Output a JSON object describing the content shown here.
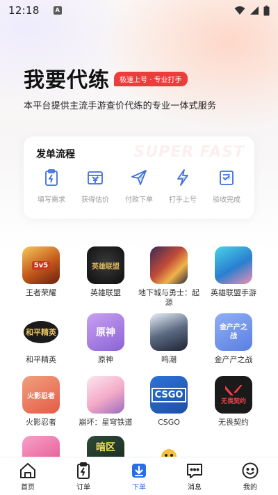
{
  "status_bar": {
    "time": "12:18",
    "indicator": "A"
  },
  "hero": {
    "title": "我要代练",
    "tag": "极速上号 · 专业打手",
    "subtitle": "本平台提供主流手游查价代练的专业一体式服务"
  },
  "flow": {
    "title": "发单流程",
    "watermark": "SUPER FAST",
    "steps": [
      {
        "label": "填写需求",
        "icon": "clipboard-icon"
      },
      {
        "label": "获得估价",
        "icon": "price-icon"
      },
      {
        "label": "付款下单",
        "icon": "send-icon"
      },
      {
        "label": "打手上号",
        "icon": "lightning-icon"
      },
      {
        "label": "验收完成",
        "icon": "checklist-icon"
      }
    ],
    "accent_color": "#3b6fe0"
  },
  "games": [
    {
      "name": "王者荣耀",
      "icon_text": "5v5"
    },
    {
      "name": "英雄联盟",
      "icon_text": "英雄联盟"
    },
    {
      "name": "地下城与勇士：起源",
      "icon_text": ""
    },
    {
      "name": "英雄联盟手游",
      "icon_text": ""
    },
    {
      "name": "和平精英",
      "icon_text": "和平精英"
    },
    {
      "name": "原神",
      "icon_text": "原神"
    },
    {
      "name": "鸣潮",
      "icon_text": ""
    },
    {
      "name": "金产产之战",
      "icon_text": "金产产之战"
    },
    {
      "name": "火影忍者",
      "icon_text": "火影忍者"
    },
    {
      "name": "崩坏：星穹铁道",
      "icon_text": ""
    },
    {
      "name": "CSGO",
      "icon_text": "CSGO"
    },
    {
      "name": "无畏契约",
      "icon_text": "无畏契约"
    },
    {
      "name": "",
      "icon_text": ""
    },
    {
      "name": "",
      "icon_text": "暗区"
    },
    {
      "name": "",
      "icon_text": ""
    }
  ],
  "bottom_nav": [
    {
      "label": "首页",
      "icon": "home-icon",
      "active": false
    },
    {
      "label": "订单",
      "icon": "order-icon",
      "active": false
    },
    {
      "label": "下单",
      "icon": "download-order-icon",
      "active": true
    },
    {
      "label": "消息",
      "icon": "message-icon",
      "active": false
    },
    {
      "label": "我的",
      "icon": "profile-icon",
      "active": false
    }
  ]
}
